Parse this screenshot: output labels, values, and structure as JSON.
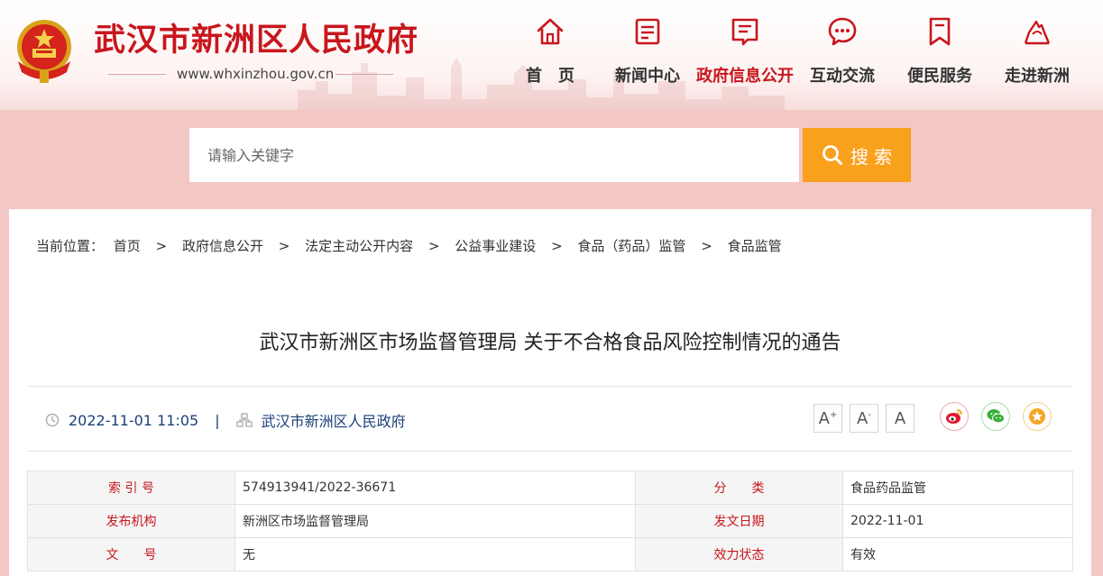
{
  "site": {
    "title": "武汉市新洲区人民政府",
    "url": "www.whxinzhou.gov.cn"
  },
  "nav": [
    {
      "label": "首　页",
      "icon": "home-icon",
      "active": false
    },
    {
      "label": "新闻中心",
      "icon": "news-icon",
      "active": false
    },
    {
      "label": "政府信息公开",
      "icon": "document-icon",
      "active": true
    },
    {
      "label": "互动交流",
      "icon": "chat-icon",
      "active": false
    },
    {
      "label": "便民服务",
      "icon": "bookmark-icon",
      "active": false
    },
    {
      "label": "走进新洲",
      "icon": "landmark-icon",
      "active": false
    }
  ],
  "search": {
    "placeholder": "请输入关键字",
    "value": "",
    "button_label": "搜 索"
  },
  "breadcrumb": {
    "prefix": "当前位置：",
    "items": [
      "首页",
      "政府信息公开",
      "法定主动公开内容",
      "公益事业建设",
      "食品（药品）监管",
      "食品监管"
    ],
    "separator": ">"
  },
  "article": {
    "title": "武汉市新洲区市场监督管理局 关于不合格食品风险控制情况的通告",
    "datetime": "2022-11-01 11:05",
    "separator": "|",
    "source": "武汉市新洲区人民政府"
  },
  "font_sizes": [
    "A",
    "A",
    "A"
  ],
  "share": [
    {
      "icon": "weibo-icon",
      "color": "#e6162d"
    },
    {
      "icon": "wechat-icon",
      "color": "#3bb03b"
    },
    {
      "icon": "favorite-star-icon",
      "color": "#f5a623"
    }
  ],
  "info_table": [
    {
      "k1": "索 引 号",
      "v1": "574913941/2022-36671",
      "k2": "分　　类",
      "v2": "食品药品监管"
    },
    {
      "k1": "发布机构",
      "v1": "新洲区市场监督管理局",
      "k2": "发文日期",
      "v2": "2022-11-01"
    },
    {
      "k1": "文　　号",
      "v1": "无",
      "k2": "效力状态",
      "v2": "有效"
    }
  ],
  "colors": {
    "brand_red": "#c8161d",
    "search_orange": "#f9a01c",
    "banner_pink": "#f3c7c4",
    "meta_blue": "#1b3f7a"
  }
}
